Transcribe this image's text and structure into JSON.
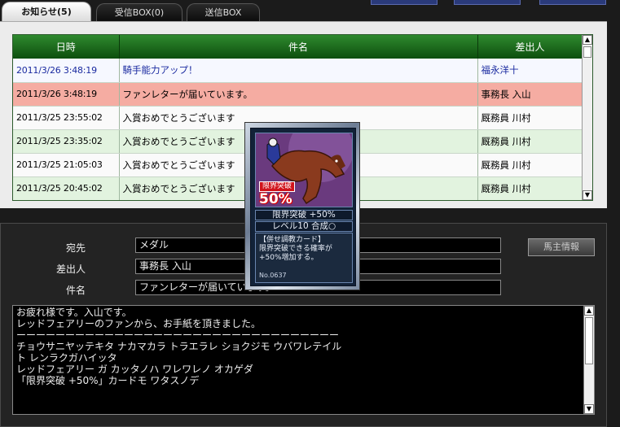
{
  "tabs": [
    {
      "label": "お知らせ(5)"
    },
    {
      "label": "受信BOX(0)"
    },
    {
      "label": "送信BOX"
    }
  ],
  "list": {
    "headers": {
      "date": "日時",
      "subject": "件名",
      "sender": "差出人"
    },
    "rows": [
      {
        "date": "2011/3/26 3:48:19",
        "subject": "騎手能力アップ！",
        "sender": "福永洋十"
      },
      {
        "date": "2011/3/26 3:48:19",
        "subject": "ファンレターが届いています。",
        "sender": "事務長 入山"
      },
      {
        "date": "2011/3/25 23:55:02",
        "subject": "入賞おめでとうございます",
        "sender": "厩務員 川村"
      },
      {
        "date": "2011/3/25 23:35:02",
        "subject": "入賞おめでとうございます",
        "sender": "厩務員 川村"
      },
      {
        "date": "2011/3/25 21:05:03",
        "subject": "入賞おめでとうございます",
        "sender": "厩務員 川村"
      },
      {
        "date": "2011/3/25 20:45:02",
        "subject": "入賞おめでとうございます",
        "sender": "厩務員 川村"
      }
    ]
  },
  "detail": {
    "to_label": "宛先",
    "to_value": "メダル",
    "from_label": "差出人",
    "from_value": "事務長 入山",
    "subject_label": "件名",
    "subject_value": "ファンレターが届いています。",
    "owner_button": "馬主情報",
    "body_lines": [
      "お疲れ様です。入山です。",
      "レッドフェアリーのファンから、お手紙を頂きました。",
      "",
      "ーーーーーーーーーーーーーーーーーーーーーーーーーーーーーーーーー",
      "チョウサニヤッテキタ ナカマカラ トラエラレ ショクジモ ウバワレテイル",
      "ト レンラクガハイッタ",
      "",
      "レッドフェアリー ガ カッタノハ ワレワレノ オカゲダ",
      "「限界突破 +50%」カードモ ワタスノデ"
    ]
  },
  "card": {
    "badge_top": "限界突破",
    "badge_value": "50%",
    "line1": "限界突破 +50%",
    "line2": "レベル10 合成○",
    "desc": "【併せ調教カード】\n限界突破できる確率が+50%増加する。",
    "number": "No.0637"
  },
  "colors": {
    "header_green": "#1f6f1f",
    "row_red": "#f5aca2",
    "row_green": "#e2f3df"
  }
}
